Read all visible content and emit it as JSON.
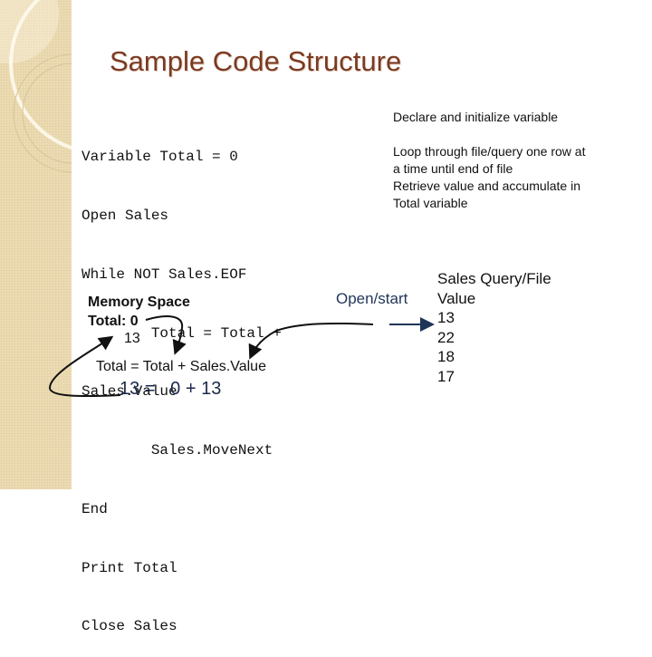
{
  "slide": {
    "title": "Sample Code Structure",
    "code_lines": [
      "Variable Total = 0",
      "Open Sales",
      "While NOT Sales.EOF",
      "        Total = Total +",
      "Sales.Value",
      "        Sales.MoveNext",
      "End",
      "Print Total",
      "Close Sales"
    ],
    "notes": {
      "declare": "Declare and initialize variable",
      "loop_lines": [
        "Loop through file/query one row at",
        "a time until end of file",
        "Retrieve value and accumulate in",
        "Total variable"
      ]
    },
    "memory": {
      "heading": "Memory Space",
      "total_label": "Total: 0",
      "new_value": "13"
    },
    "equation": {
      "formula": "Total = Total + Sales.Value",
      "values": "13 =   0 + 13"
    },
    "open_start_label": "Open/start",
    "sales_file": {
      "header_line1": "Sales Query/File",
      "header_line2": "Value",
      "values": [
        "13",
        "22",
        "18",
        "17"
      ]
    },
    "colors": {
      "title": "#7a3a22",
      "sidebar": "#ecdcb4",
      "equation_values": "#1b2a4a",
      "open_start": "#1f3558"
    }
  }
}
